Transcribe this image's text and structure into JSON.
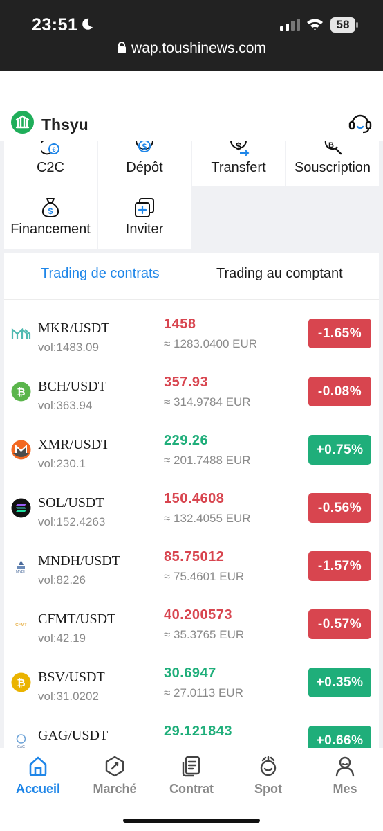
{
  "status_bar": {
    "time": "23:51",
    "battery": "58",
    "url": "wap.toushinews.com"
  },
  "header": {
    "username": "Thsyu",
    "logo_icon": "building-logo-icon",
    "support_icon": "headset-icon"
  },
  "actions": [
    {
      "label": "C2C",
      "icon": "c2c-exchange-icon"
    },
    {
      "label": "Dépôt",
      "icon": "deposit-icon"
    },
    {
      "label": "Transfert",
      "icon": "transfer-icon"
    },
    {
      "label": "Souscription",
      "icon": "subscription-icon"
    },
    {
      "label": "Financement",
      "icon": "money-bag-icon"
    },
    {
      "label": "Inviter",
      "icon": "invite-icon"
    }
  ],
  "tabs": {
    "active": "Trading de contrats",
    "inactive": "Trading au comptant"
  },
  "markets": [
    {
      "pair": "MKR/USDT",
      "vol": "vol:1483.09",
      "price": "1458",
      "eur": "≈ 1283.0400 EUR",
      "change": "-1.65%",
      "trend": "down",
      "icon": "mkr-icon"
    },
    {
      "pair": "BCH/USDT",
      "vol": "vol:363.94",
      "price": "357.93",
      "eur": "≈ 314.9784 EUR",
      "change": "-0.08%",
      "trend": "down",
      "icon": "bch-icon"
    },
    {
      "pair": "XMR/USDT",
      "vol": "vol:230.1",
      "price": "229.26",
      "eur": "≈ 201.7488 EUR",
      "change": "+0.75%",
      "trend": "up",
      "icon": "xmr-icon"
    },
    {
      "pair": "SOL/USDT",
      "vol": "vol:152.4263",
      "price": "150.4608",
      "eur": "≈ 132.4055 EUR",
      "change": "-0.56%",
      "trend": "down",
      "icon": "sol-icon"
    },
    {
      "pair": "MNDH/USDT",
      "vol": "vol:82.26",
      "price": "85.75012",
      "eur": "≈ 75.4601 EUR",
      "change": "-1.57%",
      "trend": "down",
      "icon": "mndh-icon"
    },
    {
      "pair": "CFMT/USDT",
      "vol": "vol:42.19",
      "price": "40.200573",
      "eur": "≈ 35.3765 EUR",
      "change": "-0.57%",
      "trend": "down",
      "icon": "cfmt-icon"
    },
    {
      "pair": "BSV/USDT",
      "vol": "vol:31.0202",
      "price": "30.6947",
      "eur": "≈ 27.0113 EUR",
      "change": "+0.35%",
      "trend": "up",
      "icon": "bsv-icon"
    },
    {
      "pair": "GAG/USDT",
      "vol": "",
      "price": "29.121843",
      "eur": "",
      "change": "+0.66%",
      "trend": "up",
      "icon": "gag-icon"
    }
  ],
  "nav": [
    {
      "label": "Accueil",
      "icon": "home-icon",
      "active": true
    },
    {
      "label": "Marché",
      "icon": "compass-icon",
      "active": false
    },
    {
      "label": "Contrat",
      "icon": "document-icon",
      "active": false
    },
    {
      "label": "Spot",
      "icon": "spot-icon",
      "active": false
    },
    {
      "label": "Mes",
      "icon": "profile-icon",
      "active": false
    }
  ],
  "colors": {
    "accent": "#1f86e8",
    "down": "#d8454f",
    "up": "#1fae7a",
    "brand_logo": "#1fae5a"
  }
}
